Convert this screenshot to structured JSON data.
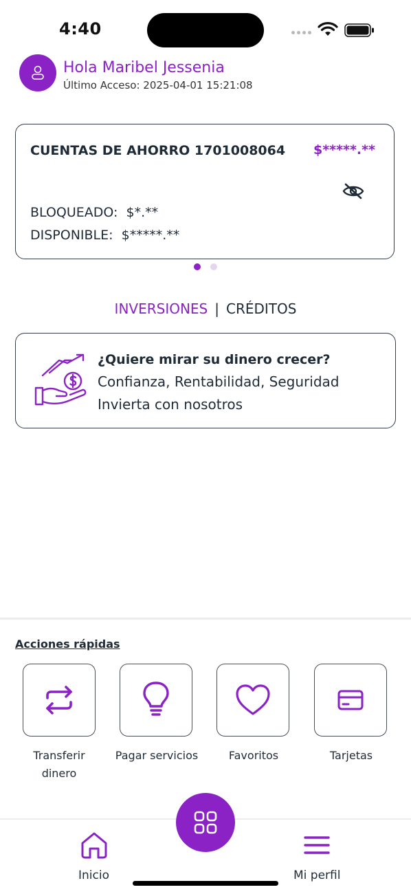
{
  "status": {
    "time": "4:40"
  },
  "header": {
    "greeting": "Hola Maribel Jessenia",
    "last_access": "Último Acceso: 2025-04-01 15:21:08"
  },
  "account": {
    "title": "CUENTAS DE AHORRO 1701008064",
    "balance": "$*****.**",
    "blocked_label": "BLOQUEADO:",
    "blocked_value": "$*.**",
    "available_label": "DISPONIBLE:",
    "available_value": "$*****.**"
  },
  "tabs": {
    "investments": "INVERSIONES",
    "separator": "|",
    "credits": "CRÉDITOS"
  },
  "promo": {
    "question": "¿Quiere mirar su dinero crecer?",
    "line1": "Confianza, Rentabilidad, Seguridad",
    "line2": "Invierta con nosotros"
  },
  "quick_actions": {
    "title": "Acciones rápidas",
    "items": [
      {
        "label1": "Transferir",
        "label2": "dinero",
        "icon": "transfer-icon"
      },
      {
        "label1": "Pagar servicios",
        "label2": "",
        "icon": "lightbulb-icon"
      },
      {
        "label1": "Favoritos",
        "label2": "",
        "icon": "heart-icon"
      },
      {
        "label1": "Tarjetas",
        "label2": "",
        "icon": "card-icon"
      }
    ]
  },
  "nav": {
    "home": "Inicio",
    "profile": "Mi perfil"
  },
  "colors": {
    "accent": "#8a22c6",
    "text": "#1f2a37"
  }
}
